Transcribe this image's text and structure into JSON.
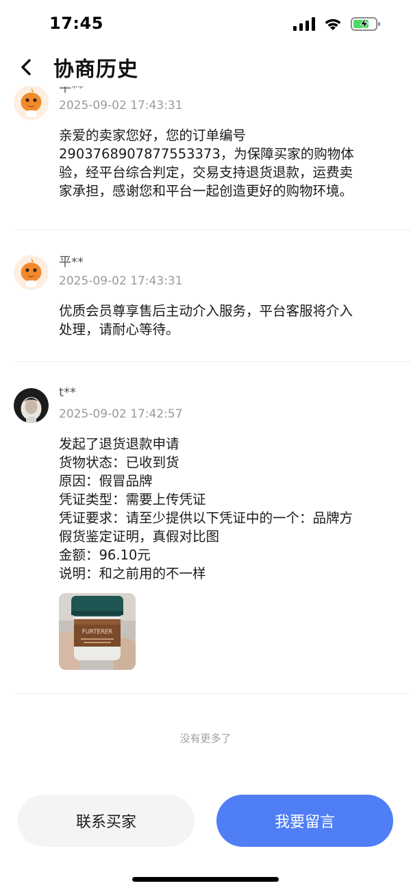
{
  "status_bar": {
    "time": "17:45"
  },
  "header": {
    "title": "协商历史"
  },
  "entries": [
    {
      "user": "平**",
      "time": "2025-09-02 17:43:31",
      "lines": [
        "亲爱的卖家您好，您的订单编号",
        "2903768907877553373，为保障买家的购物体",
        "验，经平台综合判定，交易支持退货退款，运费卖",
        "家承担，感谢您和平台一起创造更好的购物环境。"
      ]
    },
    {
      "user": "平**",
      "time": "2025-09-02 17:43:31",
      "lines": [
        "优质会员尊享售后主动介入服务，平台客服将介入",
        "处理，请耐心等待。"
      ]
    },
    {
      "user": "t**",
      "time": "2025-09-02 17:42:57",
      "lines": [
        "发起了退货退款申请",
        "货物状态：已收到货",
        "原因：假冒品牌",
        "凭证类型：需要上传凭证",
        "凭证要求：请至少提供以下凭证中的一个：品牌方",
        "假货鉴定证明，真假对比图",
        "金额：96.10元",
        "说明：和之前用的不一样"
      ],
      "product_label": "FURTERER"
    }
  ],
  "footer": {
    "no_more": "没有更多了",
    "contact_buyer": "联系买家",
    "leave_message": "我要留言"
  },
  "colors": {
    "accent": "#4f7ef5",
    "secondary_button": "#f3f4f6",
    "mascot": "#f08a2c"
  }
}
